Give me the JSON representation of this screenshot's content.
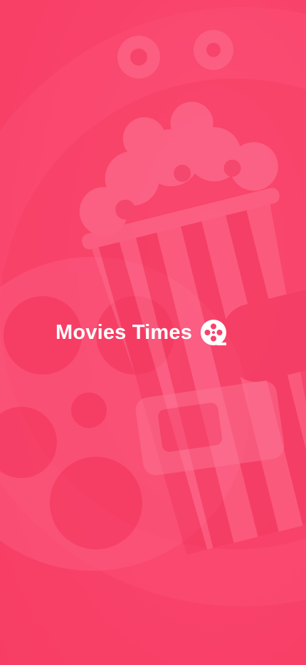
{
  "splash": {
    "app_name": "Movies Times",
    "logo_icon": "film-reel-icon",
    "background_theme": "popcorn-and-film-reel"
  },
  "colors": {
    "background": "#f9426a",
    "text": "#ffffff"
  }
}
